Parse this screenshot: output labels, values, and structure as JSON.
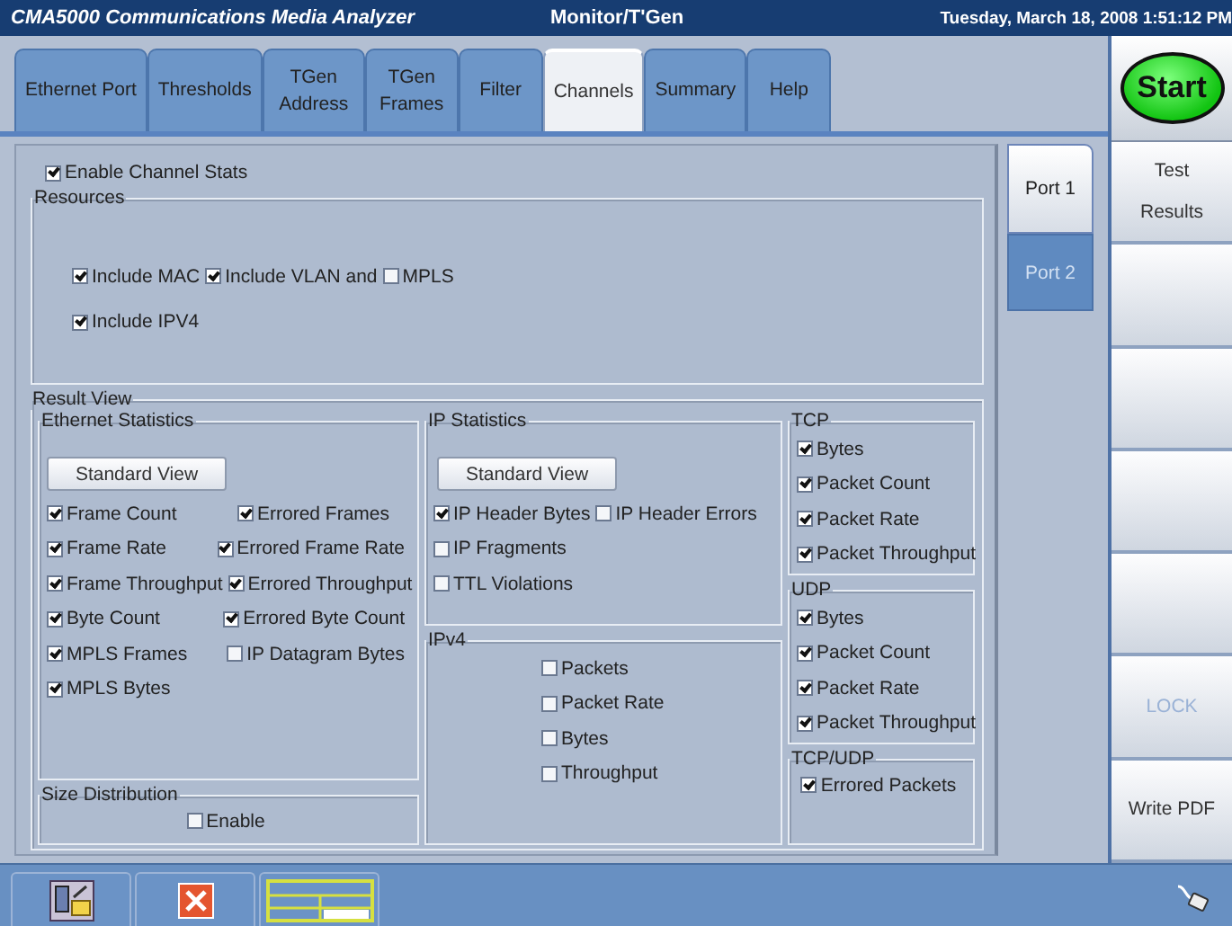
{
  "window": {
    "title": "CMA5000 Communications Media Analyzer",
    "mode": "Monitor/T'Gen",
    "datetime": "Tuesday, March 18, 2008 1:51:12 PM"
  },
  "tabs": [
    {
      "label": "Ethernet Port",
      "selected": false
    },
    {
      "label": "Thresholds",
      "selected": false
    },
    {
      "label": "TGen Address",
      "selected": false
    },
    {
      "label": "TGen Frames",
      "selected": false
    },
    {
      "label": "Filter",
      "selected": false
    },
    {
      "label": "Channels",
      "selected": true
    },
    {
      "label": "Summary",
      "selected": false
    },
    {
      "label": "Help",
      "selected": false
    }
  ],
  "enable_channel_stats": {
    "label": "Enable Channel Stats",
    "checked": true
  },
  "resources": {
    "title": "Resources",
    "rows": [
      [
        {
          "label": "Include MAC",
          "checked": true
        },
        {
          "label": "Include VLAN and",
          "checked": true
        },
        {
          "label": "MPLS",
          "checked": false
        }
      ],
      [
        {
          "label": "Include IPV4",
          "checked": true
        }
      ]
    ]
  },
  "result_view": {
    "title": "Result View",
    "ethernet_statistics": {
      "title": "Ethernet Statistics",
      "button": "Standard View",
      "rows": [
        [
          {
            "label": "Frame Count",
            "checked": true
          },
          {
            "label": "Errored Frames",
            "checked": true
          }
        ],
        [
          {
            "label": "Frame Rate",
            "checked": true
          },
          {
            "label": "Errored Frame Rate",
            "checked": true
          }
        ],
        [
          {
            "label": "Frame Throughput",
            "checked": true
          },
          {
            "label": "Errored Throughput",
            "checked": true
          }
        ],
        [
          {
            "label": "Byte Count",
            "checked": true
          },
          {
            "label": "Errored Byte Count",
            "checked": true
          }
        ],
        [
          {
            "label": "MPLS Frames",
            "checked": true
          },
          {
            "label": "IP Datagram Bytes",
            "checked": false
          }
        ],
        [
          {
            "label": "MPLS Bytes",
            "checked": true
          }
        ]
      ]
    },
    "size_distribution": {
      "title": "Size Distribution",
      "rows": [
        [
          {
            "label": "Enable",
            "checked": false
          }
        ]
      ]
    },
    "ip_statistics": {
      "title": "IP Statistics",
      "button": "Standard View",
      "rows": [
        [
          {
            "label": "IP Header Bytes",
            "checked": true
          },
          {
            "label": "IP Header Errors",
            "checked": false
          }
        ],
        [
          {
            "label": "IP Fragments",
            "checked": false
          }
        ],
        [
          {
            "label": "TTL Violations",
            "checked": false
          }
        ]
      ]
    },
    "ipv4": {
      "title": "IPv4",
      "rows": [
        [
          {
            "label": "Packets",
            "checked": false
          }
        ],
        [
          {
            "label": "Packet Rate",
            "checked": false
          }
        ],
        [
          {
            "label": "Bytes",
            "checked": false
          }
        ],
        [
          {
            "label": "Throughput",
            "checked": false
          }
        ]
      ]
    },
    "tcp": {
      "title": "TCP",
      "rows": [
        [
          {
            "label": "Bytes",
            "checked": true
          }
        ],
        [
          {
            "label": "Packet Count",
            "checked": true
          }
        ],
        [
          {
            "label": "Packet Rate",
            "checked": true
          }
        ],
        [
          {
            "label": "Packet Throughput",
            "checked": true
          }
        ]
      ]
    },
    "udp": {
      "title": "UDP",
      "rows": [
        [
          {
            "label": "Bytes",
            "checked": true
          }
        ],
        [
          {
            "label": "Packet Count",
            "checked": true
          }
        ],
        [
          {
            "label": "Packet Rate",
            "checked": true
          }
        ],
        [
          {
            "label": "Packet Throughput",
            "checked": true
          }
        ]
      ]
    },
    "tcp_udp": {
      "title": "TCP/UDP",
      "rows": [
        [
          {
            "label": "Errored Packets",
            "checked": true
          }
        ]
      ]
    }
  },
  "port_tabs": [
    {
      "label": "Port 1",
      "selected": true
    },
    {
      "label": "Port 2",
      "selected": false
    }
  ],
  "start_button": {
    "label": "Start"
  },
  "side_buttons": [
    {
      "kind": "label",
      "label": "Test Results",
      "disabled": false
    },
    {
      "kind": "blank"
    },
    {
      "kind": "blank"
    },
    {
      "kind": "blank"
    },
    {
      "kind": "blank"
    },
    {
      "kind": "label",
      "label": "LOCK",
      "disabled": true
    },
    {
      "kind": "label",
      "label": "Write PDF",
      "disabled": false
    }
  ]
}
